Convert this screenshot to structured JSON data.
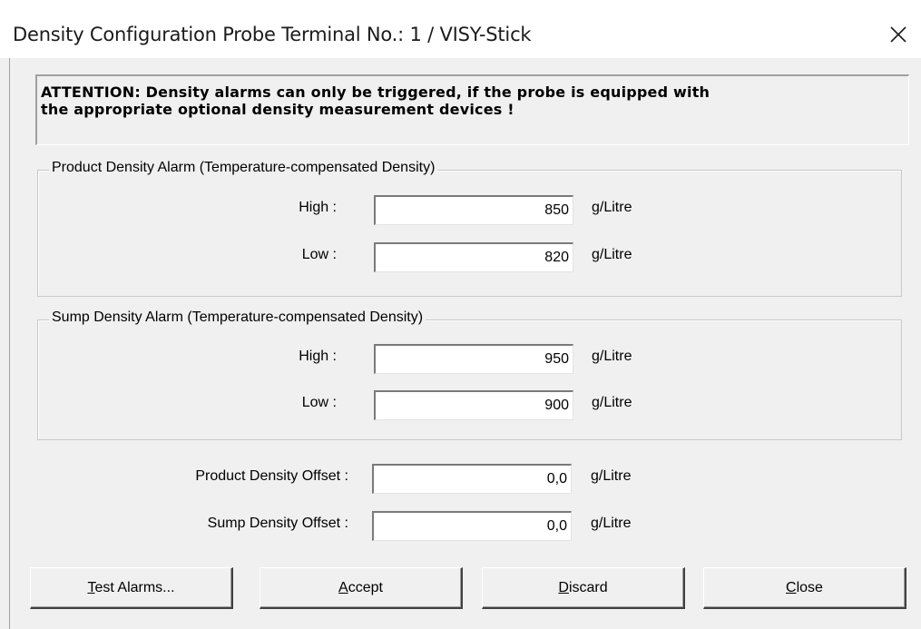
{
  "window": {
    "title": "Density Configuration Probe Terminal No.: 1 / VISY-Stick"
  },
  "attention": {
    "line1": "ATTENTION: Density alarms can only be triggered, if the probe is equipped with",
    "line2": "the appropriate optional density measurement devices !"
  },
  "product_group": {
    "legend": "Product Density Alarm (Temperature-compensated Density)",
    "high_label": "High :",
    "high_value": "850",
    "low_label": "Low :",
    "low_value": "820",
    "unit": "g/Litre"
  },
  "sump_group": {
    "legend": "Sump Density Alarm (Temperature-compensated Density)",
    "high_label": "High :",
    "high_value": "950",
    "low_label": "Low :",
    "low_value": "900",
    "unit": "g/Litre"
  },
  "offsets": {
    "product_label": "Product Density Offset :",
    "product_value": "0,0",
    "sump_label": "Sump Density Offset :",
    "sump_value": "0,0",
    "unit": "g/Litre"
  },
  "buttons": {
    "test_alarms": {
      "mnemonic": "T",
      "rest": "est Alarms..."
    },
    "accept": {
      "mnemonic": "A",
      "rest": "ccept"
    },
    "discard": {
      "mnemonic": "D",
      "rest": "iscard"
    },
    "close": {
      "mnemonic": "C",
      "rest": "lose"
    }
  },
  "icons": {
    "close": "close-icon"
  }
}
